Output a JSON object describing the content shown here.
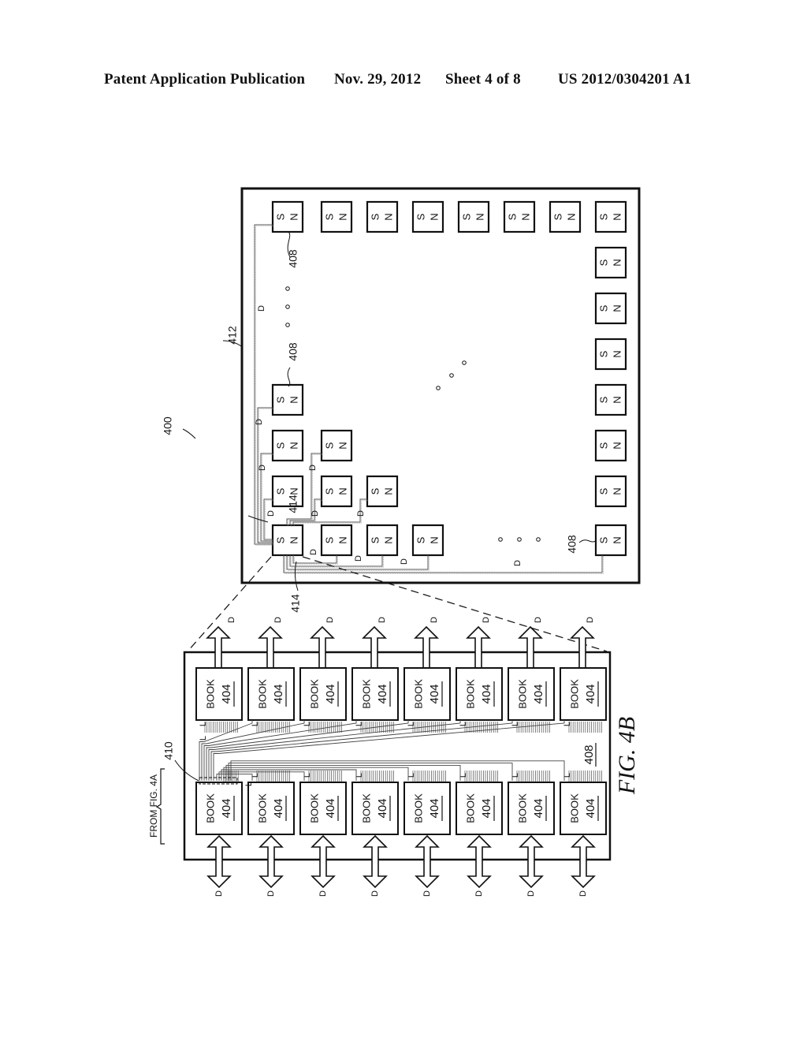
{
  "header": {
    "publication": "Patent Application Publication",
    "date": "Nov. 29, 2012",
    "sheet": "Sheet 4 of 8",
    "number": "US 2012/0304201 A1"
  },
  "figure": {
    "label": "FIG. 4B",
    "ref_system": "400",
    "ref_board": "412",
    "ref_node": "408",
    "ref_node_inner": "408",
    "ref_link": "414",
    "ref_bus": "410",
    "from_label": "FROM FIG. 4A",
    "node_s": "S",
    "node_n": "N",
    "link_d": "D",
    "link_l": "L",
    "book_label": "BOOK",
    "book_ref": "404",
    "ellipsis": "o  o  o"
  }
}
